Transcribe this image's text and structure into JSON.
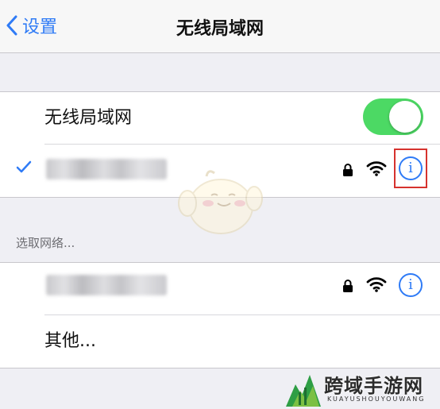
{
  "navbar": {
    "back_label": "设置",
    "title": "无线局域网"
  },
  "wifi_toggle": {
    "label": "无线局域网",
    "on": true
  },
  "section_header": "选取网络...",
  "other_label": "其他...",
  "watermark": {
    "text": "跨域手游网",
    "subtext": "KUAYUSHOUYOUWANG"
  },
  "colors": {
    "accent": "#2f7bf6",
    "toggle_on": "#4cd964",
    "highlight": "#d6322e",
    "background": "#efeff4"
  }
}
